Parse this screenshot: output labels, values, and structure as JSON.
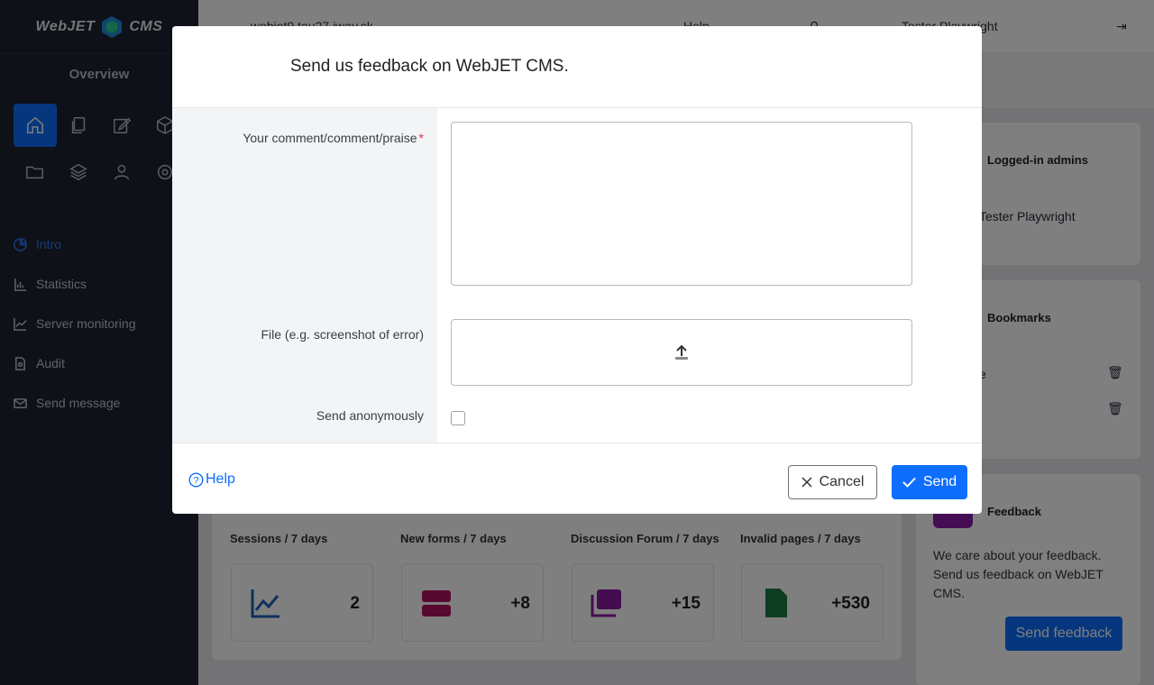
{
  "app": {
    "logo_left": "WebJET",
    "logo_right": "CMS",
    "overview_label": "Overview"
  },
  "sidebar": {
    "nav": [
      {
        "label": "Intro",
        "icon": "pie-chart-icon"
      },
      {
        "label": "Statistics",
        "icon": "bar-chart-icon"
      },
      {
        "label": "Server monitoring",
        "icon": "line-chart-icon"
      },
      {
        "label": "Audit",
        "icon": "file-search-icon"
      },
      {
        "label": "Send message",
        "icon": "message-icon"
      }
    ]
  },
  "topbar": {
    "host": "webjet9.tau27.iway.sk",
    "help": "Help",
    "user": "Tester Playwright"
  },
  "cards": {
    "logged_in": {
      "title": "Logged-in admins",
      "user": "Tester Playwright"
    },
    "bookmarks": {
      "title": "Bookmarks",
      "item": "e"
    },
    "feedback": {
      "title": "Feedback",
      "text": "We care about your feedback. Send us feedback on WebJET CMS.",
      "button": "Send feedback"
    }
  },
  "stats": [
    {
      "label": "Sessions / 7 days",
      "value": "2",
      "color": "#1f5fbf"
    },
    {
      "label": "New forms / 7 days",
      "value": "+8",
      "color": "#b0135f"
    },
    {
      "label": "Discussion Forum / 7 days",
      "value": "+15",
      "color": "#8b1a9e"
    },
    {
      "label": "Invalid pages / 7 days",
      "value": "+530",
      "color": "#1e7b43"
    }
  ],
  "modal": {
    "title": "Send us feedback on WebJET CMS.",
    "comment_label": "Your comment/comment/praise",
    "required_mark": "*",
    "comment_value": "",
    "file_label": "File (e.g. screenshot of error)",
    "anonymous_label": "Send anonymously",
    "help_label": "Help",
    "cancel_label": "Cancel",
    "send_label": "Send"
  },
  "colors": {
    "primary": "#0d6efd",
    "sidebar_bg": "#1e2330"
  }
}
